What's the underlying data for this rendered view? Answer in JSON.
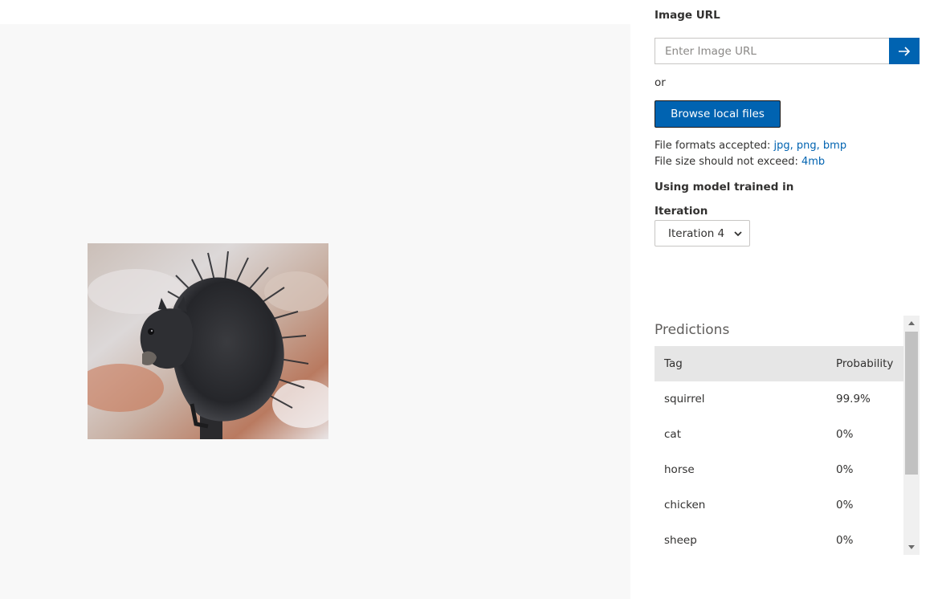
{
  "preview": {
    "image_alt": "squirrel"
  },
  "image_url": {
    "label": "Image URL",
    "placeholder": "Enter Image URL",
    "submit_icon": "arrow-right-icon"
  },
  "or_text": "or",
  "browse_button_label": "Browse local files",
  "file_info": {
    "formats_prefix": "File formats accepted: ",
    "formats_value": "jpg, png, bmp",
    "size_prefix": "File size should not exceed: ",
    "size_value": "4mb"
  },
  "model": {
    "heading": "Using model trained in",
    "iteration_label": "Iteration",
    "iteration_selected": "Iteration 4"
  },
  "predictions": {
    "title": "Predictions",
    "columns": [
      "Tag",
      "Probability"
    ],
    "rows": [
      {
        "tag": "squirrel",
        "probability": "99.9%"
      },
      {
        "tag": "cat",
        "probability": "0%"
      },
      {
        "tag": "horse",
        "probability": "0%"
      },
      {
        "tag": "chicken",
        "probability": "0%"
      },
      {
        "tag": "sheep",
        "probability": "0%"
      }
    ]
  },
  "colors": {
    "accent": "#0063b1",
    "preview_background": "#f8f8f8",
    "table_header": "#e6e6e6"
  }
}
